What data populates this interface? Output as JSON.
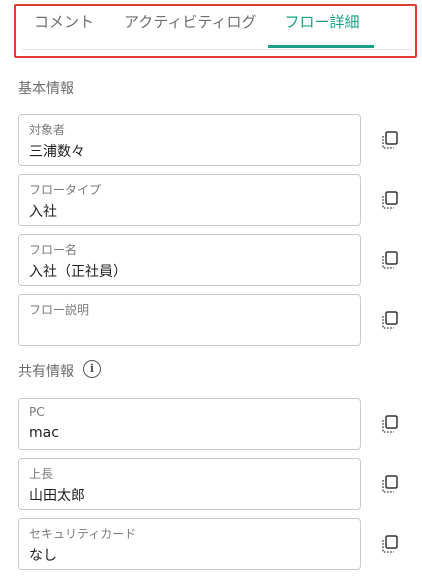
{
  "tabs": [
    {
      "label": "コメント",
      "active": false
    },
    {
      "label": "アクティビティログ",
      "active": false
    },
    {
      "label": "フロー詳細",
      "active": true
    }
  ],
  "colors": {
    "accent": "#1a9f84",
    "highlight_frame": "#e53935"
  },
  "sections": {
    "basic": {
      "title": "基本情報",
      "fields": [
        {
          "label": "対象者",
          "value": "三浦数々"
        },
        {
          "label": "フロータイプ",
          "value": "入社"
        },
        {
          "label": "フロー名",
          "value": "入社（正社員）"
        },
        {
          "label": "フロー説明",
          "value": ""
        }
      ]
    },
    "shared": {
      "title": "共有情報",
      "info_icon": "info-circle-icon",
      "fields": [
        {
          "label": "PC",
          "value": "mac"
        },
        {
          "label": "上長",
          "value": "山田太郎"
        },
        {
          "label": "セキュリティカード",
          "value": "なし"
        }
      ]
    }
  },
  "copy_icon": "copy-icon"
}
